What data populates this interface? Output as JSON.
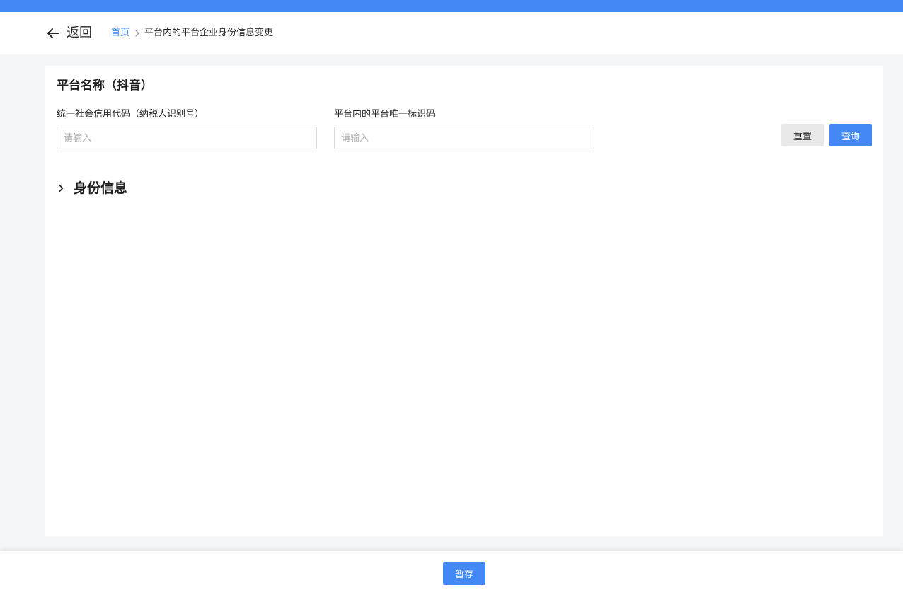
{
  "header": {
    "back_label": "返回",
    "breadcrumb": {
      "home": "首页",
      "current": "平台内的平台企业身份信息变更"
    }
  },
  "form": {
    "title": "平台名称（抖音）",
    "fields": [
      {
        "label": "统一社会信用代码（纳税人识别号）",
        "placeholder": "请输入",
        "value": ""
      },
      {
        "label": "平台内的平台唯一标识码",
        "placeholder": "请输入",
        "value": ""
      }
    ],
    "reset_label": "重置",
    "query_label": "查询"
  },
  "section": {
    "title": "身份信息",
    "icon": "chevron-right-icon",
    "expanded": false
  },
  "footer": {
    "save_label": "暂存"
  },
  "colors": {
    "primary": "#4488f5",
    "reset_bg": "#e8e8e8",
    "page_bg": "#f5f6f8"
  }
}
